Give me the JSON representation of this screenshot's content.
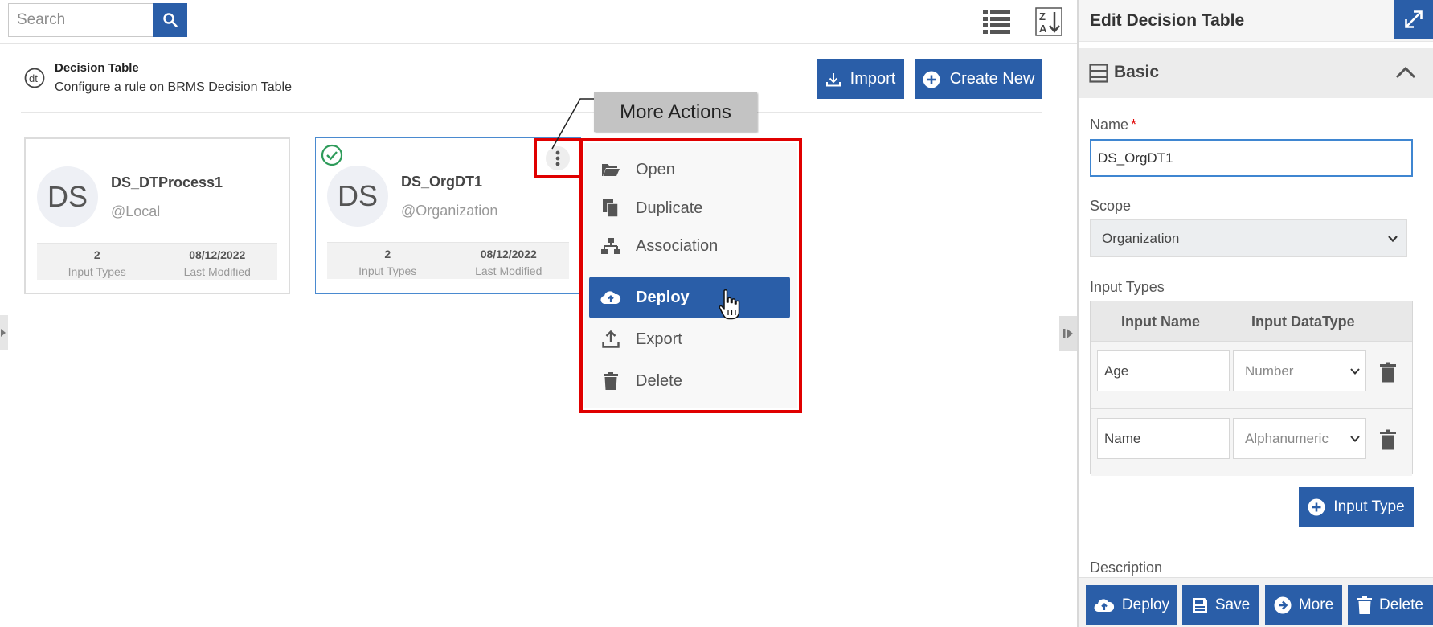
{
  "toolbar": {
    "search_placeholder": "Search",
    "icons": {
      "search": "search-icon",
      "list_view": "list-view-icon",
      "sort": "sort-az-icon"
    }
  },
  "header": {
    "title": "Decision Table",
    "subtitle": "Configure a rule on BRMS Decision Table",
    "import_label": "Import",
    "create_label": "Create New"
  },
  "cards": [
    {
      "initials": "DS",
      "name": "DS_DTProcess1",
      "scope": "@Local",
      "input_types_value": "2",
      "input_types_label": "Input Types",
      "modified_value": "08/12/2022",
      "modified_label": "Last Modified",
      "selected": false
    },
    {
      "initials": "DS",
      "name": "DS_OrgDT1",
      "scope": "@Organization",
      "input_types_value": "2",
      "input_types_label": "Input Types",
      "modified_value": "08/12/2022",
      "modified_label": "Last Modified",
      "selected": true,
      "deployed": true
    }
  ],
  "callout": {
    "label": "More Actions"
  },
  "context_menu": {
    "items": [
      {
        "label": "Open",
        "icon": "folder-open-icon"
      },
      {
        "label": "Duplicate",
        "icon": "copy-icon"
      },
      {
        "label": "Association",
        "icon": "sitemap-icon"
      },
      {
        "label": "Deploy",
        "icon": "cloud-upload-icon",
        "active": true
      },
      {
        "label": "Export",
        "icon": "upload-icon"
      },
      {
        "label": "Delete",
        "icon": "trash-icon"
      }
    ]
  },
  "panel": {
    "title": "Edit Decision Table",
    "section_title": "Basic",
    "name_label": "Name",
    "name_value": "DS_OrgDT1",
    "scope_label": "Scope",
    "scope_value": "Organization",
    "input_types_label": "Input Types",
    "columns": {
      "name": "Input Name",
      "datatype": "Input DataType"
    },
    "rows": [
      {
        "name": "Age",
        "datatype": "Number"
      },
      {
        "name": "Name",
        "datatype": "Alphanumeric"
      }
    ],
    "add_input_type_label": "Input Type",
    "description_label": "Description",
    "footer": {
      "deploy": "Deploy",
      "save": "Save",
      "more": "More",
      "delete": "Delete"
    }
  },
  "colors": {
    "primary": "#2a5ea8",
    "highlight": "#e00000",
    "success": "#2e9b5a"
  }
}
